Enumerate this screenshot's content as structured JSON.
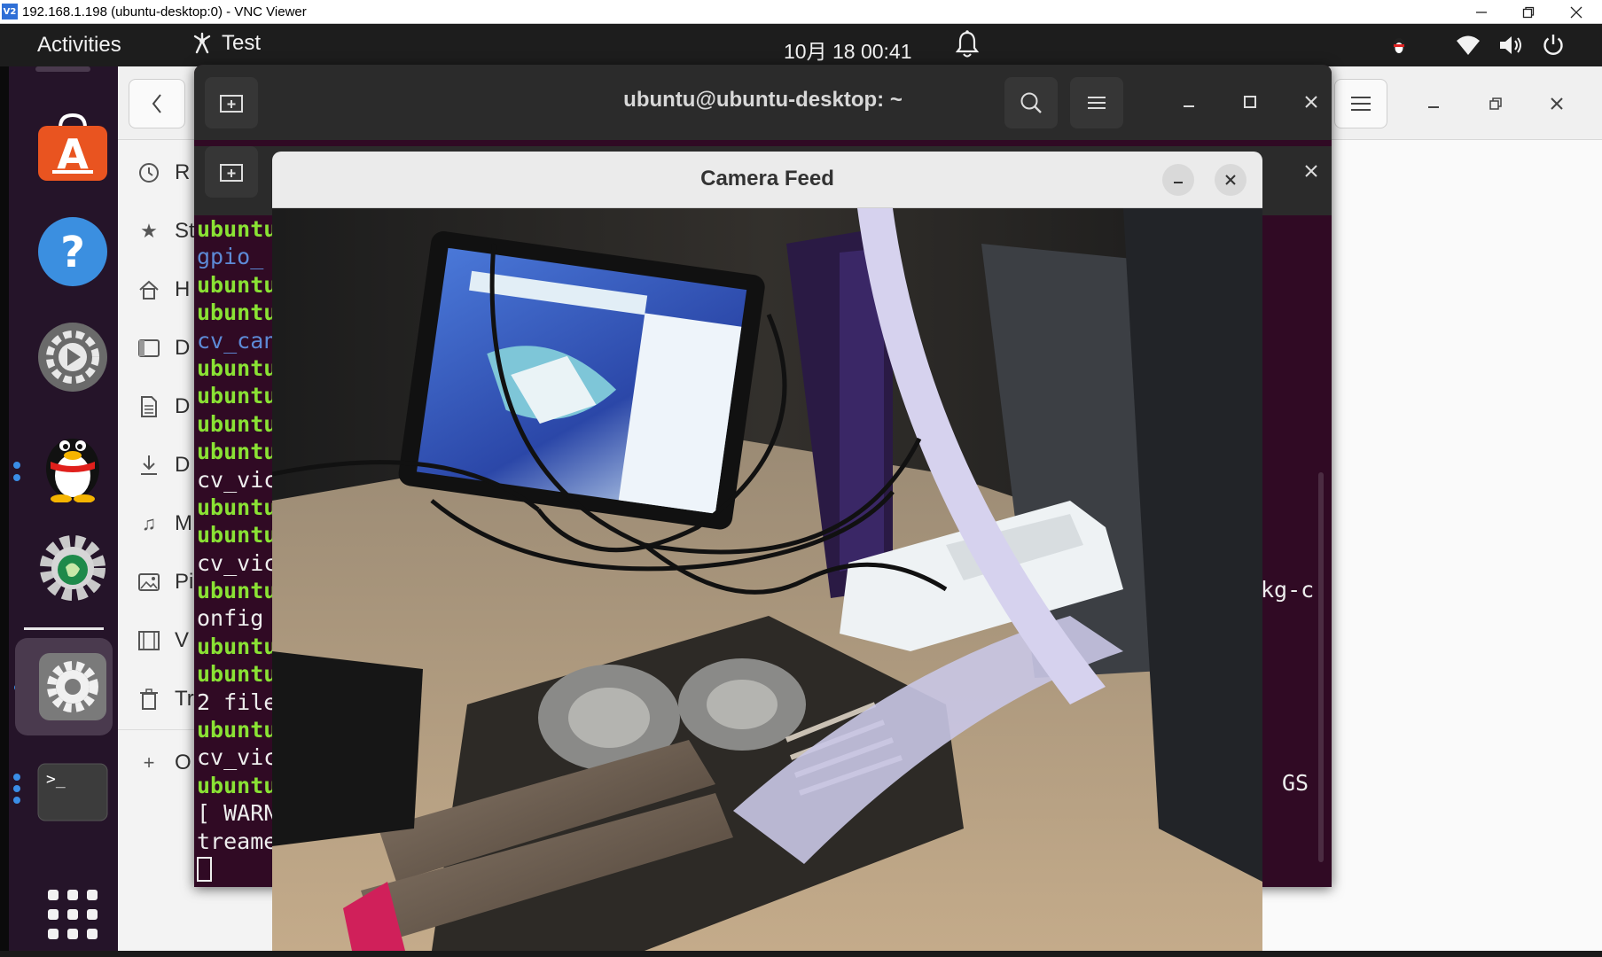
{
  "vnc": {
    "title": "192.168.1.198 (ubuntu-desktop:0) - VNC Viewer",
    "logo": "V2",
    "controls": [
      "minimize-icon",
      "restore-icon",
      "close-icon"
    ]
  },
  "topbar": {
    "activities": "Activities",
    "app_name": "Test",
    "clock": "10月 18  00:41",
    "tray_icons": [
      "notification-bell-icon",
      "app-indicator-icon",
      "wifi-icon",
      "volume-icon",
      "power-icon"
    ]
  },
  "dock": {
    "items": [
      "ubuntu-software-icon",
      "help-icon",
      "settings-app-icon",
      "qq-penguin-icon",
      "gear-app-icon",
      "system-settings-icon",
      "terminal-icon",
      "show-apps-grid-icon"
    ],
    "accent": "#3a8ee6"
  },
  "files": {
    "sidebar": [
      {
        "icon": "recent-icon",
        "label": "R"
      },
      {
        "icon": "star-icon",
        "label": "St"
      },
      {
        "icon": "home-icon",
        "label": "H"
      },
      {
        "icon": "desktop-icon",
        "label": "D"
      },
      {
        "icon": "documents-icon",
        "label": "D"
      },
      {
        "icon": "downloads-icon",
        "label": "D"
      },
      {
        "icon": "music-icon",
        "label": "M"
      },
      {
        "icon": "pictures-icon",
        "label": "Pi"
      },
      {
        "icon": "videos-icon",
        "label": "V"
      },
      {
        "icon": "trash-icon",
        "label": "Tr"
      },
      {
        "icon": "plus-icon",
        "label": "O"
      }
    ]
  },
  "terminal": {
    "title": "ubuntu@ubuntu-desktop: ~",
    "background": "#300a24",
    "lines": [
      {
        "text": "ubuntu",
        "color": "green"
      },
      {
        "text": "gpio_",
        "color": "blue"
      },
      {
        "text": "ubuntu",
        "color": "green"
      },
      {
        "text": "ubuntu",
        "color": "green"
      },
      {
        "text": "cv_can",
        "color": "blue"
      },
      {
        "text": "ubuntu",
        "color": "green"
      },
      {
        "text": "ubuntu",
        "color": "green"
      },
      {
        "text": "ubuntu",
        "color": "green"
      },
      {
        "text": "ubuntu",
        "color": "green"
      },
      {
        "text": "cv_vic",
        "color": "white"
      },
      {
        "text": "ubuntu",
        "color": "green"
      },
      {
        "text": "ubuntu",
        "color": "green"
      },
      {
        "text": "cv_vic",
        "color": "white"
      },
      {
        "text": "ubuntu",
        "color": "green"
      },
      {
        "text": "onfig",
        "color": "white"
      },
      {
        "text": "ubuntu",
        "color": "green"
      },
      {
        "text": "ubuntu",
        "color": "green"
      },
      {
        "text": "2 file",
        "color": "white"
      },
      {
        "text": "ubuntu",
        "color": "green"
      },
      {
        "text": "cv_vic",
        "color": "white"
      },
      {
        "text": "ubuntu",
        "color": "green"
      },
      {
        "text": "[ WARN",
        "color": "white"
      },
      {
        "text": "treame",
        "color": "white"
      }
    ],
    "right_fragment_1": "kg-c",
    "right_fragment_2": "GS"
  },
  "camera": {
    "title": "Camera Feed",
    "minimize_label": "–",
    "close_label": "✕"
  }
}
